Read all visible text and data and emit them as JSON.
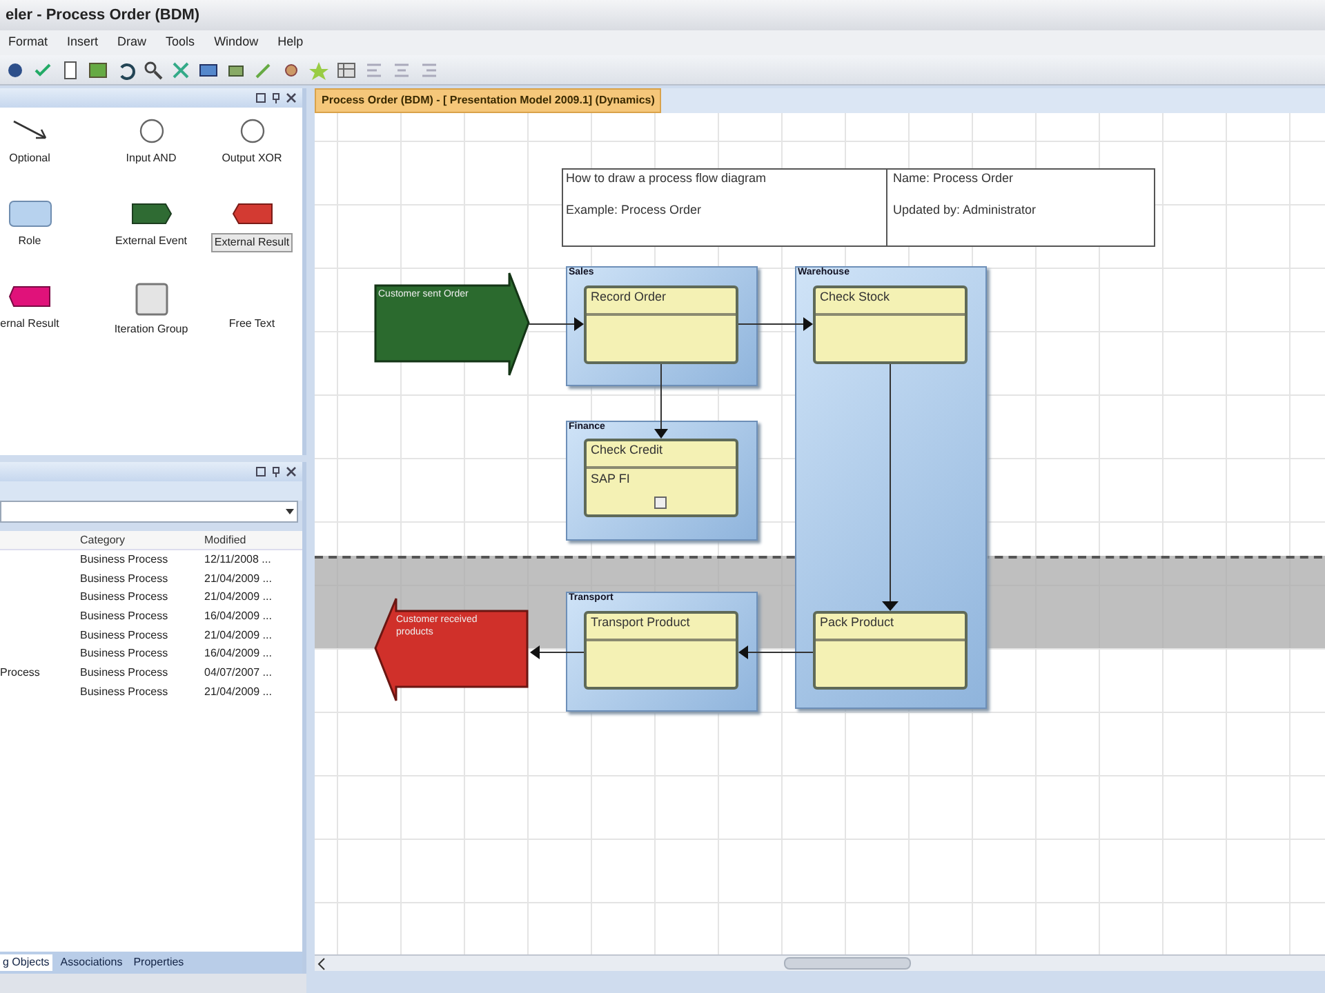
{
  "window": {
    "title": "eler - Process Order (BDM)"
  },
  "menu": [
    "Format",
    "Insert",
    "Draw",
    "Tools",
    "Window",
    "Help"
  ],
  "palette": {
    "items": [
      {
        "label": "Optional",
        "kind": "connector",
        "selected": false
      },
      {
        "label": "Input AND",
        "kind": "gateway",
        "selected": false
      },
      {
        "label": "Output XOR",
        "kind": "gateway",
        "selected": false
      },
      {
        "label": "Role",
        "kind": "role",
        "selected": false
      },
      {
        "label": "External Event",
        "kind": "event",
        "selected": false
      },
      {
        "label": "External Result",
        "kind": "result",
        "selected": true
      },
      {
        "label": "ernal Result",
        "kind": "internal",
        "selected": false
      },
      {
        "label": "Iteration Group",
        "kind": "group",
        "selected": false
      },
      {
        "label": "Free Text",
        "kind": "text",
        "selected": false
      }
    ]
  },
  "objects": {
    "columns": [
      "Category",
      "Modified"
    ],
    "rows": [
      {
        "category": "Business Process",
        "modified": "12/11/2008 ..."
      },
      {
        "category": "Business Process",
        "modified": "21/04/2009 ..."
      },
      {
        "category": "Business Process",
        "modified": "21/04/2009 ..."
      },
      {
        "category": "Business Process",
        "modified": "16/04/2009 ..."
      },
      {
        "category": "Business Process",
        "modified": "21/04/2009 ..."
      },
      {
        "category": "Business Process",
        "modified": "16/04/2009 ..."
      },
      {
        "name": "Process",
        "category": "Business Process",
        "modified": "04/07/2007 ..."
      },
      {
        "category": "Business Process",
        "modified": "21/04/2009 ..."
      }
    ]
  },
  "panel_tabs": [
    {
      "label": "g Objects",
      "selected": true
    },
    {
      "label": "Associations",
      "selected": false
    },
    {
      "label": "Properties",
      "selected": false
    }
  ],
  "document_tab": {
    "label": "Process Order (BDM) - [ Presentation Model 2009.1] (Dynamics)"
  },
  "diagram": {
    "header": {
      "left": [
        "How to draw a process flow diagram",
        "Example: Process Order"
      ],
      "right": [
        "Name:  Process Order",
        "Updated by:  Administrator"
      ]
    },
    "lanes": [
      {
        "name": "Sales",
        "activities": [
          {
            "name": "Record Order"
          }
        ]
      },
      {
        "name": "Warehouse",
        "activities": [
          {
            "name": "Check Stock"
          },
          {
            "name": "Pack Product"
          }
        ]
      },
      {
        "name": "Finance",
        "activities": [
          {
            "name": "Check Credit",
            "system": "SAP FI"
          }
        ]
      },
      {
        "name": "Transport",
        "activities": [
          {
            "name": "Transport Product"
          }
        ]
      }
    ],
    "events": [
      {
        "label": "Customer sent Order",
        "kind": "start"
      },
      {
        "label": "Customer received products",
        "kind": "end"
      }
    ]
  }
}
